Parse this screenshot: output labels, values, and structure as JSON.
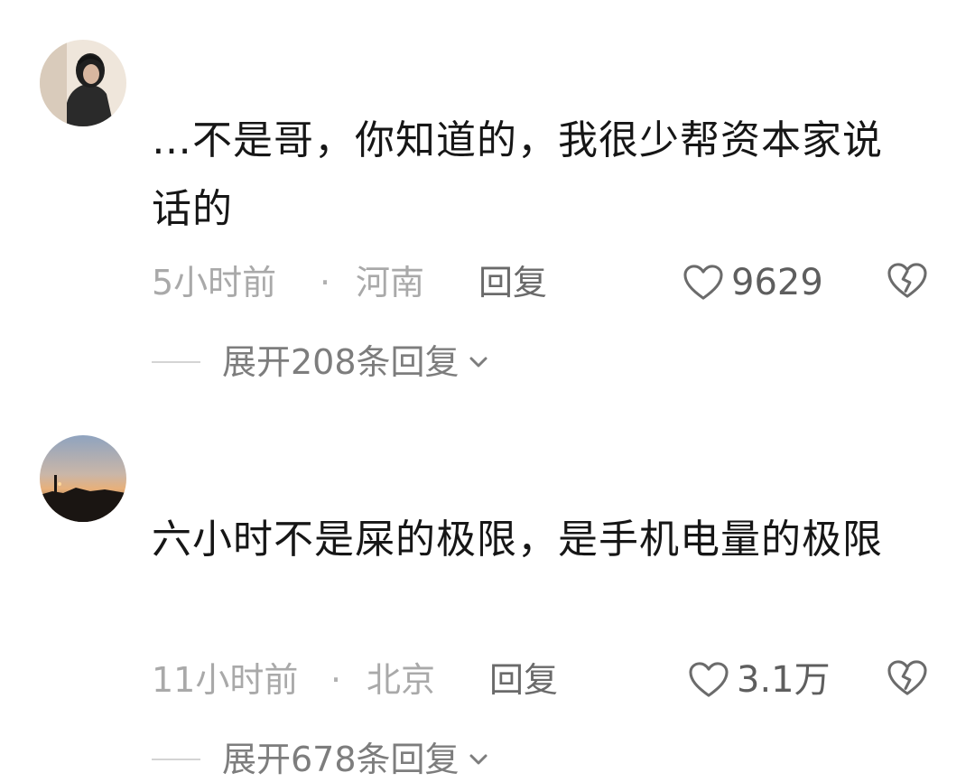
{
  "comments": [
    {
      "text": "…不是哥，你知道的，我很少帮资本家说话的",
      "time": "5小时前",
      "separator": "·",
      "location": "河南",
      "reply_label": "回复",
      "like_count": "9629",
      "expand_label": "展开208条回复",
      "avatar_icon": "user-avatar-hooded-person"
    },
    {
      "text": "六小时不是屎的极限，是手机电量的极限",
      "time": "11小时前",
      "separator": "·",
      "location": "北京",
      "reply_label": "回复",
      "like_count": "3.1万",
      "expand_label": "展开678条回复",
      "avatar_icon": "user-avatar-sunset"
    }
  ],
  "icons": {
    "like": "heart-outline-icon",
    "dislike": "broken-heart-icon",
    "expand": "chevron-down-icon"
  },
  "colors": {
    "meta_text": "#a9a9a9",
    "reply_text": "#6a6a6a",
    "icon_stroke": "#6b6b6b"
  }
}
